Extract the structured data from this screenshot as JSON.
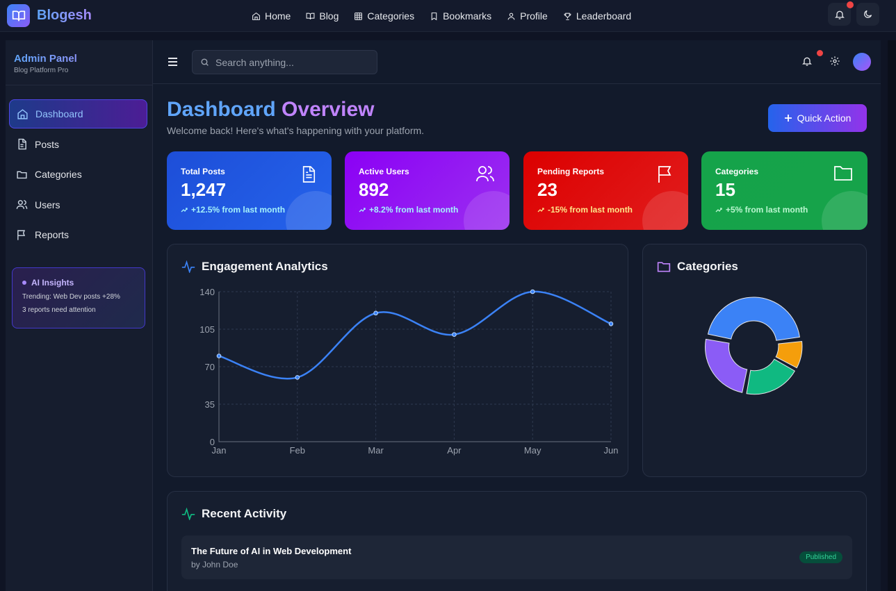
{
  "brand": {
    "name": "Blogesh"
  },
  "nav": {
    "links": [
      {
        "label": "Home",
        "icon": "home-icon"
      },
      {
        "label": "Blog",
        "icon": "book-icon"
      },
      {
        "label": "Categories",
        "icon": "grid-icon"
      },
      {
        "label": "Bookmarks",
        "icon": "bookmark-icon"
      },
      {
        "label": "Profile",
        "icon": "user-icon"
      },
      {
        "label": "Leaderboard",
        "icon": "trophy-icon"
      }
    ]
  },
  "sidebar": {
    "title": "Admin Panel",
    "subtitle": "Blog Platform Pro",
    "items": [
      {
        "label": "Dashboard",
        "icon": "home-icon",
        "active": true
      },
      {
        "label": "Posts",
        "icon": "document-icon"
      },
      {
        "label": "Categories",
        "icon": "folder-icon"
      },
      {
        "label": "Users",
        "icon": "users-icon"
      },
      {
        "label": "Reports",
        "icon": "flag-icon"
      }
    ],
    "insights": {
      "title": "AI Insights",
      "lines": [
        "Trending: Web Dev posts +28%",
        "3 reports need attention"
      ]
    }
  },
  "search": {
    "placeholder": "Search anything..."
  },
  "header": {
    "title_part1": "Dashboard",
    "title_part2": "Overview",
    "subtitle": "Welcome back! Here's what's happening with your platform.",
    "quick_action": "Quick Action"
  },
  "stats": [
    {
      "label": "Total Posts",
      "value": "1,247",
      "trend": "+12.5% from last month",
      "color": "#1d4ed8",
      "trend_color": "#a5f3fc",
      "icon": "document-icon"
    },
    {
      "label": "Active Users",
      "value": "892",
      "trend": "+8.2% from last month",
      "color": "#8b1cf0",
      "trend_color": "#a5f3fc",
      "icon": "users-icon"
    },
    {
      "label": "Pending Reports",
      "value": "23",
      "trend": "-15% from last month",
      "color": "#dc0a0a",
      "trend_color": "#fde68a",
      "icon": "flag-icon"
    },
    {
      "label": "Categories",
      "value": "15",
      "trend": "+5% from last month",
      "color": "#16a34a",
      "trend_color": "#bbf7d0",
      "icon": "folder-icon"
    }
  ],
  "engagement": {
    "title": "Engagement Analytics",
    "chart_data": {
      "type": "line",
      "categories": [
        "Jan",
        "Feb",
        "Mar",
        "Apr",
        "May",
        "Jun"
      ],
      "series": [
        {
          "values": [
            80,
            60,
            120,
            100,
            140,
            110
          ]
        }
      ],
      "ylim": [
        0,
        140
      ],
      "yticks": [
        0,
        35,
        70,
        105,
        140
      ],
      "grid": true,
      "color": "#3b82f6"
    }
  },
  "categories_panel": {
    "title": "Categories",
    "chart_data": {
      "type": "pie",
      "values": [
        45,
        10,
        20,
        25
      ],
      "colors": [
        "#3b82f6",
        "#f59e0b",
        "#10b981",
        "#8b5cf6"
      ]
    }
  },
  "activity": {
    "title": "Recent Activity",
    "items": [
      {
        "title": "The Future of AI in Web Development",
        "author": "by John Doe",
        "status": "Published"
      }
    ]
  },
  "colors": {
    "accent": "#3b82f6",
    "accent2": "#a855f7",
    "alert": "#ef4444"
  }
}
